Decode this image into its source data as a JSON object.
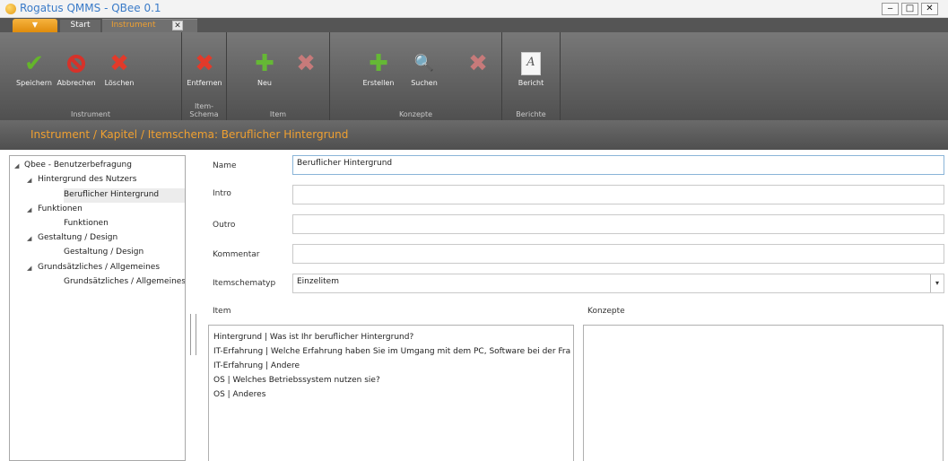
{
  "window": {
    "title": "Rogatus QMMS - QBee 0.1",
    "controls": {
      "minimize": "‒",
      "maximize": "□",
      "close": "✕"
    }
  },
  "tabs": {
    "app_menu": "▼",
    "start": "Start",
    "instrument": "Instrument",
    "close_glyph": "✕"
  },
  "ribbon": {
    "groups": [
      {
        "label": "Instrument",
        "buttons": [
          "Speichern",
          "Abbrechen",
          "Löschen"
        ]
      },
      {
        "label": "Item-Schema",
        "buttons": [
          "Entfernen"
        ]
      },
      {
        "label": "Item",
        "buttons": [
          "Neu",
          ""
        ]
      },
      {
        "label": "Konzepte",
        "buttons": [
          "Erstellen",
          "Suchen",
          ""
        ]
      },
      {
        "label": "Berichte",
        "buttons": [
          "Bericht"
        ]
      }
    ],
    "report_glyph": "A"
  },
  "breadcrumb": "Instrument / Kapitel / Itemschema: Beruflicher Hintergrund",
  "tree": {
    "arrow": "◢",
    "nodes": [
      "Qbee - Benutzerbefragung",
      "Hintergrund des Nutzers",
      "Beruflicher Hintergrund",
      "Funktionen",
      "Funktionen",
      "Gestaltung / Design",
      "Gestaltung / Design",
      "Grundsätzliches / Allgemeines",
      "Grundsätzliches / Allgemeines"
    ]
  },
  "form": {
    "name_label": "Name",
    "name_value": "Beruflicher Hintergrund",
    "intro_label": "Intro",
    "intro_value": "",
    "outro_label": "Outro",
    "outro_value": "",
    "kommentar_label": "Kommentar",
    "kommentar_value": "",
    "itemschematyp_label": "Itemschematyp",
    "itemschematyp_value": "Einzelitem",
    "item_label": "Item",
    "konzepte_label": "Konzepte",
    "items": [
      "Hintergrund | Was ist Ihr beruflicher Hintergrund?",
      "IT-Erfahrung | Welche Erfahrung haben Sie im Umgang mit dem PC, Software bei der Fra",
      "IT-Erfahrung | Andere",
      "OS | Welches Betriebssystem nutzen sie?",
      "OS | Anderes"
    ]
  },
  "colors": {
    "accent": "#f0a030",
    "ribbon": "#5f5f5f",
    "save_green": "#64b52a",
    "delete_red": "#e23a2a"
  }
}
